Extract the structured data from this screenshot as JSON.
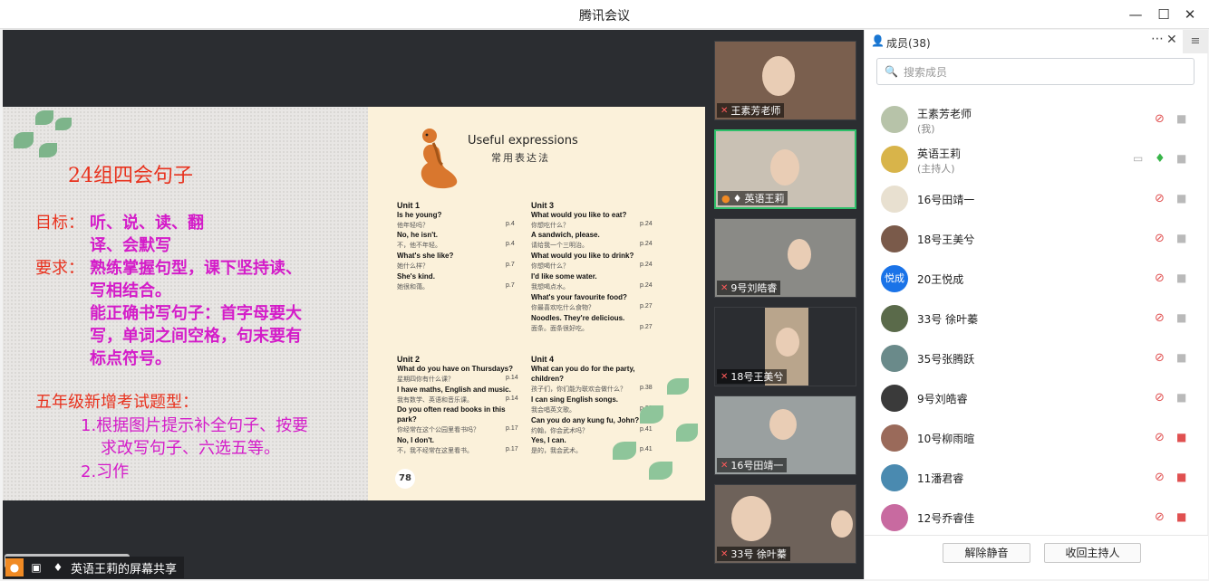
{
  "window": {
    "title": "腾讯会议",
    "minimize": "—",
    "maximize": "☐",
    "close": "✕"
  },
  "slide": {
    "title": "24组四会句子",
    "goal_label": "目标：",
    "goal_text": "听、说、读、翻",
    "goal_text2": "译、会默写",
    "req_label": "要求：",
    "req_text1": "熟练掌握句型，课下坚持读、",
    "req_text2": "写相结合。",
    "req_text3": "能正确书写句子：首字母要大",
    "req_text4": "写，单词之间空格，句末要有",
    "req_text5": "标点符号。",
    "grade_title": "五年级新增考试题型：",
    "item1a": "1.根据图片提示补全句子、按要",
    "item1b": "求改写句子、六选五等。",
    "item2": "2.习作"
  },
  "book": {
    "title": "Useful expressions",
    "subtitle": "常用表达法",
    "page_number": "78",
    "unit1": {
      "heading": "Unit 1",
      "lines": [
        {
          "en": "Is he young?",
          "cn": "他年轻吗？",
          "pg": "p.4"
        },
        {
          "en": "No, he isn't.",
          "cn": "不，他不年轻。",
          "pg": "p.4"
        },
        {
          "en": "What's she like?",
          "cn": "她什么样？",
          "pg": "p.7"
        },
        {
          "en": "She's kind.",
          "cn": "她很和蔼。",
          "pg": "p.7"
        }
      ]
    },
    "unit2": {
      "heading": "Unit 2",
      "lines": [
        {
          "en": "What do you have on Thursdays?",
          "cn": "星期四你有什么课？",
          "pg": "p.14"
        },
        {
          "en": "I have maths, English and music.",
          "cn": "我有数学、英语和音乐课。",
          "pg": "p.14"
        },
        {
          "en": "Do you often read books in this",
          "cn": "",
          "pg": ""
        },
        {
          "en": "park?",
          "cn": "你经常在这个公园里看书吗？",
          "pg": "p.17"
        },
        {
          "en": "No, I don't.",
          "cn": "不，我不经常在这里看书。",
          "pg": "p.17"
        }
      ]
    },
    "unit3": {
      "heading": "Unit 3",
      "lines": [
        {
          "en": "What would you like to eat?",
          "cn": "你想吃什么？",
          "pg": "p.24"
        },
        {
          "en": "A sandwich, please.",
          "cn": "请给我一个三明治。",
          "pg": "p.24"
        },
        {
          "en": "What would you like to drink?",
          "cn": "你想喝什么？",
          "pg": "p.24"
        },
        {
          "en": "I'd like some water.",
          "cn": "我想喝点水。",
          "pg": "p.24"
        },
        {
          "en": "What's your favourite food?",
          "cn": "你最喜欢吃什么食物？",
          "pg": "p.27"
        },
        {
          "en": "Noodles. They're delicious.",
          "cn": "面条。面条很好吃。",
          "pg": "p.27"
        }
      ]
    },
    "unit4": {
      "heading": "Unit 4",
      "lines": [
        {
          "en": "What can you do for the party,",
          "cn": "",
          "pg": ""
        },
        {
          "en": "children?",
          "cn": "孩子们，你们能为联欢会做什么？",
          "pg": "p.38"
        },
        {
          "en": "I can sing English songs.",
          "cn": "我会唱英文歌。",
          "pg": "p.38"
        },
        {
          "en": "Can you do any kung fu, John?",
          "cn": "约翰，你会武术吗？",
          "pg": "p.41"
        },
        {
          "en": "Yes, I can.",
          "cn": "是的，我会武术。",
          "pg": "p.41"
        }
      ]
    }
  },
  "share_label": "英语王莉的屏幕共享",
  "video_tiles": [
    {
      "name": "王素芳老师",
      "active": false
    },
    {
      "name": "英语王莉",
      "active": true
    },
    {
      "name": "9号刘皓睿",
      "active": false
    },
    {
      "name": "18号王美兮",
      "active": false
    },
    {
      "name": "16号田靖一",
      "active": false
    },
    {
      "name": "33号 徐叶蓁",
      "active": false
    }
  ],
  "panel": {
    "title": "成员(38)",
    "search_placeholder": "搜索成员",
    "members": [
      {
        "name": "王素芳老师",
        "sub": "(我)",
        "avatar": "",
        "avatar_color": "#b7c3a9",
        "mic": "muted",
        "cam": "on"
      },
      {
        "name": "英语王莉",
        "sub": "(主持人)",
        "avatar": "",
        "avatar_color": "#d8b44a",
        "mic": "active",
        "cam": "on",
        "screen": true
      },
      {
        "name": "16号田靖一",
        "sub": "",
        "avatar": "",
        "avatar_color": "#e8e0d0",
        "mic": "muted",
        "cam": "on"
      },
      {
        "name": "18号王美兮",
        "sub": "",
        "avatar": "",
        "avatar_color": "#7a5a4a",
        "mic": "muted",
        "cam": "on"
      },
      {
        "name": "20王悦成",
        "sub": "",
        "avatar": "悦成",
        "avatar_color": "#1a73e8",
        "mic": "muted",
        "cam": "on"
      },
      {
        "name": "33号 徐叶蓁",
        "sub": "",
        "avatar": "",
        "avatar_color": "#5a6a4a",
        "mic": "muted",
        "cam": "on"
      },
      {
        "name": "35号张腾跃",
        "sub": "",
        "avatar": "",
        "avatar_color": "#6a8a8a",
        "mic": "muted",
        "cam": "on"
      },
      {
        "name": "9号刘皓睿",
        "sub": "",
        "avatar": "",
        "avatar_color": "#3a3a3a",
        "mic": "muted",
        "cam": "on"
      },
      {
        "name": "10号柳雨暄",
        "sub": "",
        "avatar": "",
        "avatar_color": "#9a6a5a",
        "mic": "muted",
        "cam": "off"
      },
      {
        "name": "11潘君睿",
        "sub": "",
        "avatar": "",
        "avatar_color": "#4a8ab0",
        "mic": "muted",
        "cam": "off"
      },
      {
        "name": "12号乔睿佳",
        "sub": "",
        "avatar": "",
        "avatar_color": "#c86aa0",
        "mic": "muted",
        "cam": "off"
      }
    ],
    "unmute_all": "解除静音",
    "reclaim_host": "收回主持人"
  }
}
